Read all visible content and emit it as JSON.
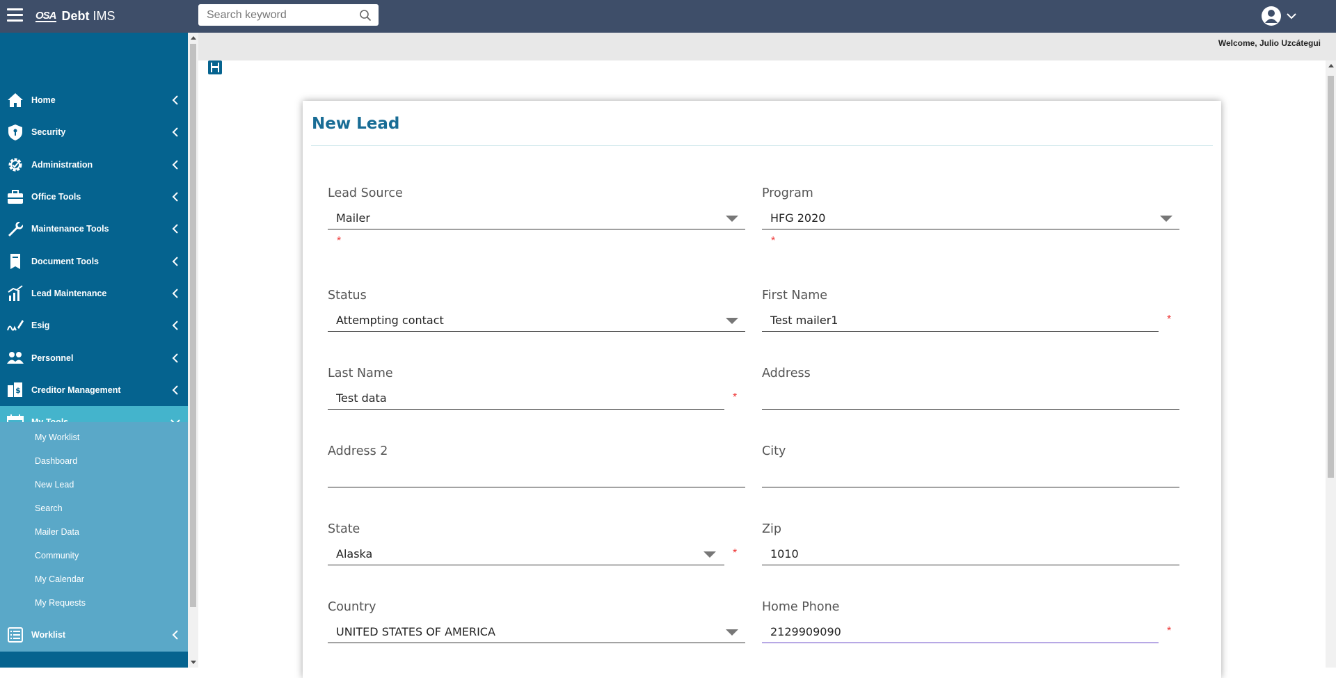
{
  "app": {
    "logo_mark": "OSA",
    "name_bold": "Debt",
    "name_rest": "IMS"
  },
  "search": {
    "placeholder": "Search keyword"
  },
  "welcome": "Welcome, Julio Uzcátegui",
  "sidebar": {
    "items": [
      {
        "label": "Home",
        "icon": "home-icon"
      },
      {
        "label": "Security",
        "icon": "shield-icon"
      },
      {
        "label": "Administration",
        "icon": "gear-check-icon"
      },
      {
        "label": "Office Tools",
        "icon": "briefcase-icon"
      },
      {
        "label": "Maintenance Tools",
        "icon": "wrench-icon"
      },
      {
        "label": "Document Tools",
        "icon": "document-icon"
      },
      {
        "label": "Lead Maintenance",
        "icon": "chart-icon"
      },
      {
        "label": "Esig",
        "icon": "signature-icon"
      },
      {
        "label": "Personnel",
        "icon": "people-icon"
      },
      {
        "label": "Creditor Management",
        "icon": "creditor-icon"
      },
      {
        "label": "My Tools",
        "icon": "calendar-icon"
      },
      {
        "label": "Worklist",
        "icon": "list-icon"
      }
    ],
    "my_tools_sub": [
      "My Worklist",
      "Dashboard",
      "New Lead",
      "Search",
      "Mailer Data",
      "Community",
      "My Calendar",
      "My Requests"
    ]
  },
  "form": {
    "title": "New Lead",
    "required_mark": "*",
    "lead_source": {
      "label": "Lead Source",
      "value": "Mailer"
    },
    "program": {
      "label": "Program",
      "value": "HFG 2020"
    },
    "status": {
      "label": "Status",
      "value": "Attempting contact"
    },
    "first_name": {
      "label": "First Name",
      "value": "Test mailer1"
    },
    "last_name": {
      "label": "Last Name",
      "value": "Test data"
    },
    "address": {
      "label": "Address",
      "value": ""
    },
    "address2": {
      "label": "Address 2",
      "value": ""
    },
    "city": {
      "label": "City",
      "value": ""
    },
    "state": {
      "label": "State",
      "value": "Alaska"
    },
    "zip": {
      "label": "Zip",
      "value": "1010"
    },
    "country": {
      "label": "Country",
      "value": "UNITED STATES OF AMERICA"
    },
    "home_phone": {
      "label": "Home Phone",
      "value": "2129909090"
    }
  },
  "colors": {
    "topbar": "#3e4e69",
    "sidebar": "#05638f",
    "active": "#44b4cc",
    "submenu": "#5aa8c8",
    "title": "#186c95",
    "required": "#e33333"
  }
}
